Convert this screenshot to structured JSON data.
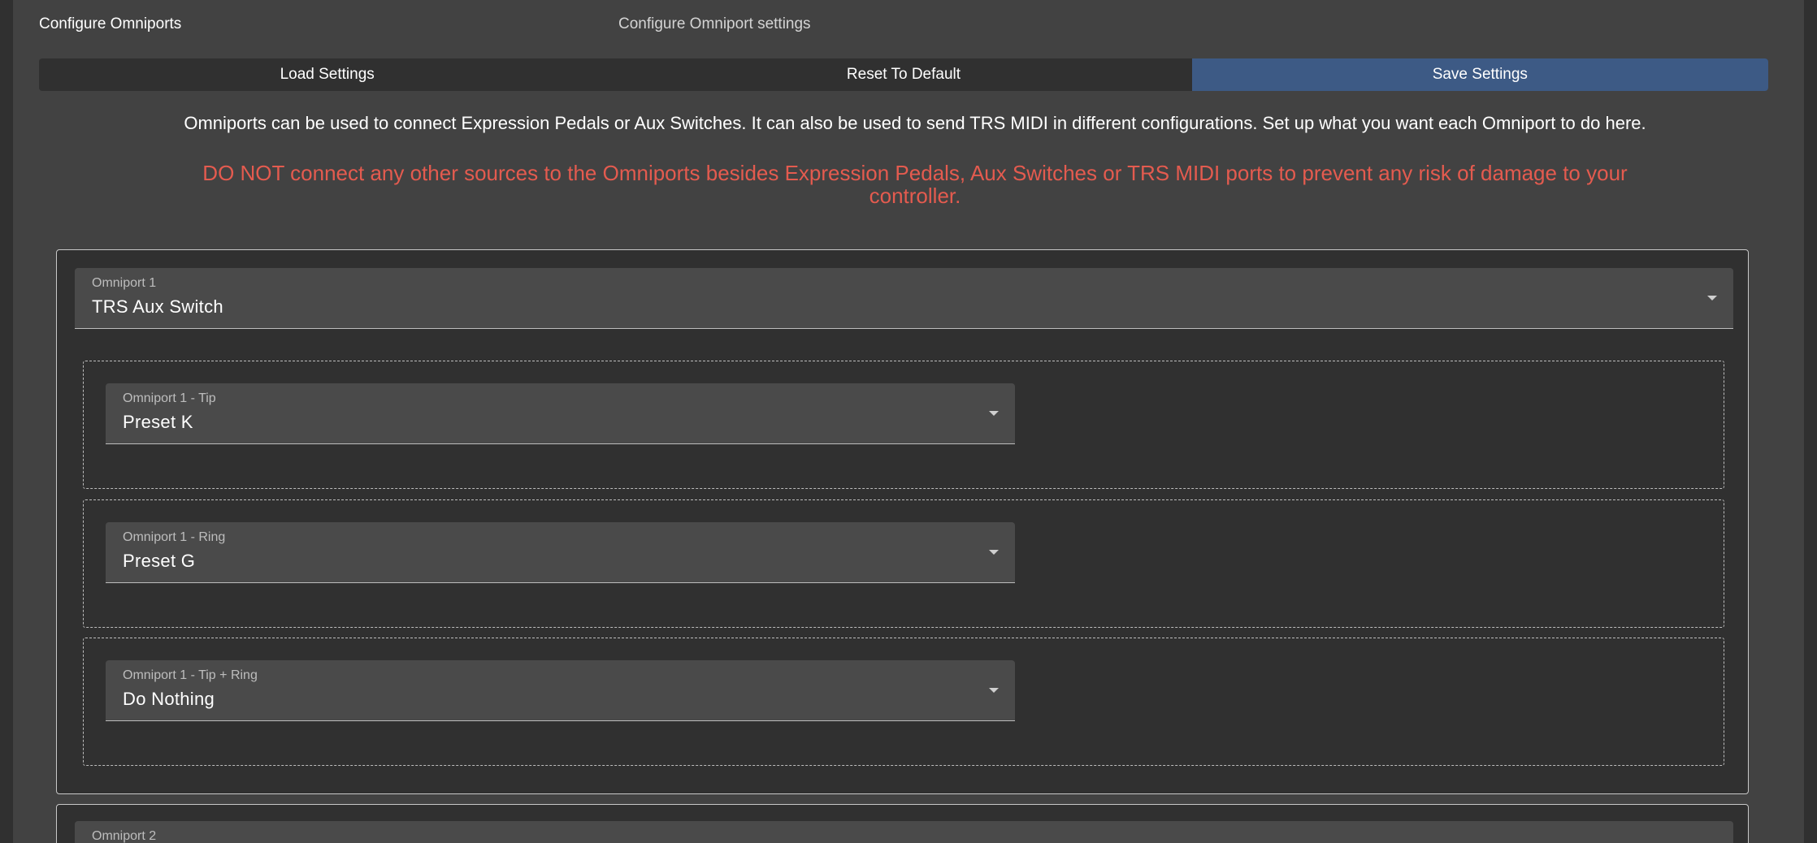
{
  "topbar": {
    "title": "Configure Omniports",
    "subtitle": "Configure Omniport settings"
  },
  "actions": {
    "load": "Load Settings",
    "reset": "Reset To Default",
    "save": "Save Settings"
  },
  "info_text": "Omniports can be used to connect Expression Pedals or Aux Switches. It can also be used to send TRS MIDI in different configurations. Set up what you want each Omniport to do here.",
  "warning_text": "DO NOT connect any other sources to the Omniports besides Expression Pedals, Aux Switches or TRS MIDI ports to prevent any risk of damage to your controller.",
  "colors": {
    "save_button": "#3d5a85",
    "warning": "#e45b4f"
  },
  "omniports": [
    {
      "label": "Omniport 1",
      "value": "TRS Aux Switch",
      "sub_settings": [
        {
          "label": "Omniport 1 - Tip",
          "value": "Preset K"
        },
        {
          "label": "Omniport 1 - Ring",
          "value": "Preset G"
        },
        {
          "label": "Omniport 1 - Tip + Ring",
          "value": "Do Nothing"
        }
      ]
    },
    {
      "label": "Omniport 2"
    }
  ]
}
